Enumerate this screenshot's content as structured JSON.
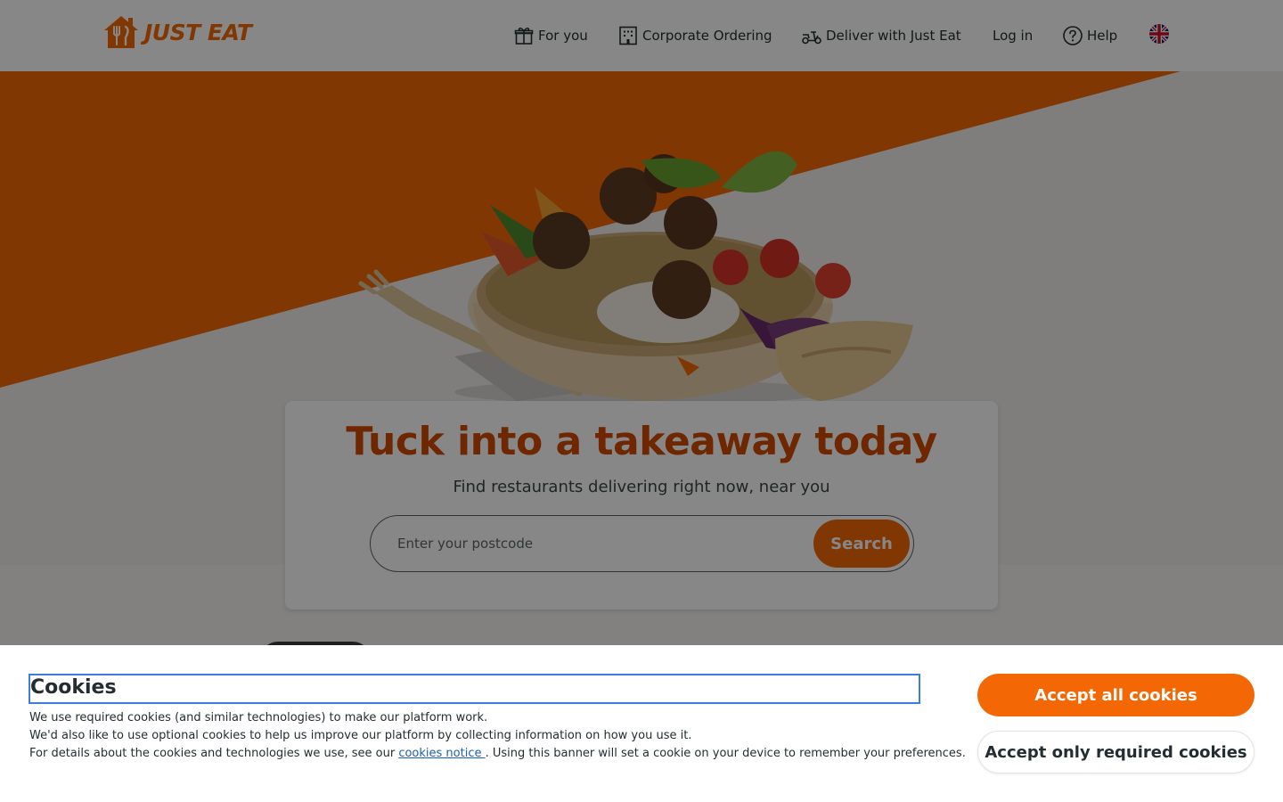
{
  "brand": {
    "name": "JUST EAT",
    "accent_color": "#f36805",
    "headline_color": "#d14a00"
  },
  "nav": {
    "items": [
      {
        "label": "For you",
        "icon": "gift-icon"
      },
      {
        "label": "Corporate Ordering",
        "icon": "building-icon"
      },
      {
        "label": "Deliver with Just Eat",
        "icon": "scooter-icon"
      },
      {
        "label": "Log in"
      },
      {
        "label": "Help",
        "icon": "help-circle-icon"
      }
    ],
    "language_icon": "uk-flag-icon"
  },
  "hero": {
    "headline": "Tuck into a takeaway today",
    "subheadline": "Find restaurants delivering right now, near you",
    "postcode_placeholder": "Enter your postcode",
    "search_label": "Search"
  },
  "cookie_banner": {
    "title": "Cookies",
    "line1": "We use required cookies (and similar technologies) to make our platform work.",
    "line2": "We'd also like to use optional cookies to help us improve our platform by collecting information on how you use it.",
    "line3_before": "For details about the cookies and technologies we use, see our ",
    "link_text": "cookies notice ",
    "line3_after": ". Using this banner will set a cookie on your device to remember your preferences.",
    "accept_all": "Accept all cookies",
    "accept_required": "Accept only required cookies"
  }
}
